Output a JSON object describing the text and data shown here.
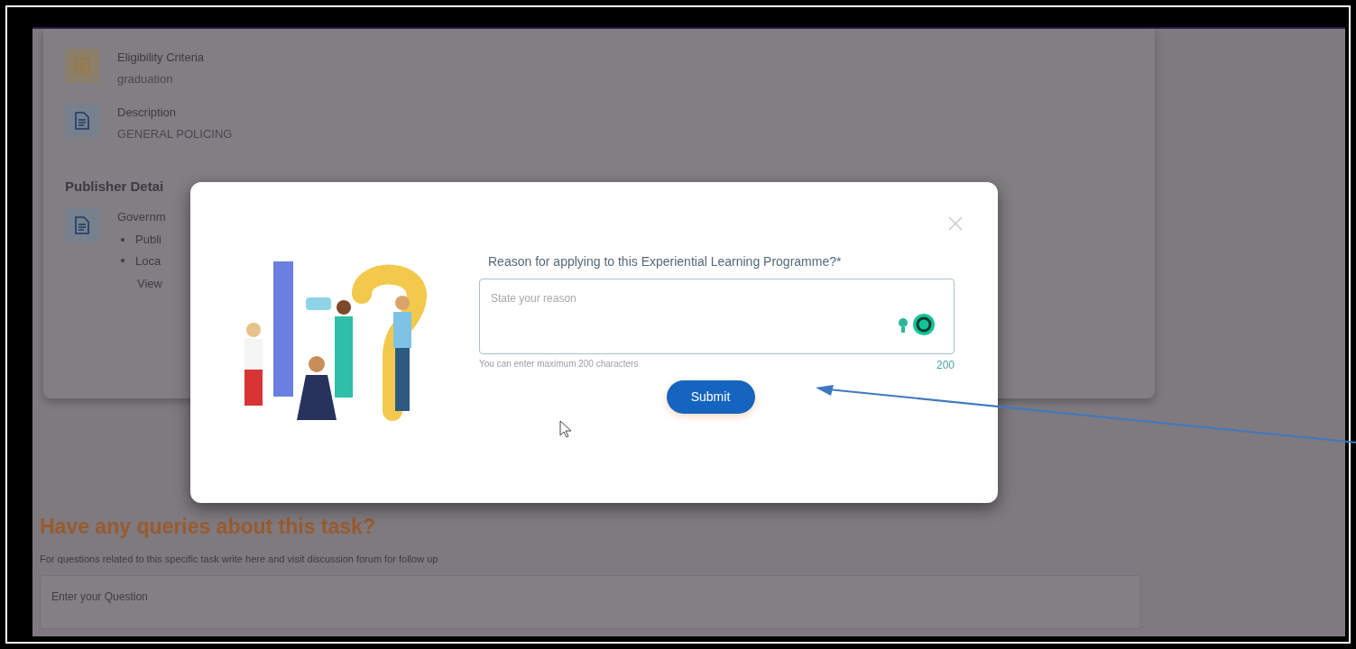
{
  "details": [
    {
      "kind": "grid",
      "label": "Eligibility Criteria",
      "value": "graduation"
    },
    {
      "kind": "document",
      "label": "Description",
      "value": "GENERAL POLICING"
    }
  ],
  "publisher": {
    "heading": "Publisher Detai",
    "label": "Governm",
    "bullets": [
      "Publi",
      "Loca"
    ],
    "link": "View"
  },
  "queries": {
    "heading": "Have any queries about this task?",
    "subtext": "For questions related to this specific task write here and visit discussion forum for follow up",
    "placeholder": "Enter your Question"
  },
  "modal": {
    "label": "Reason for applying to this Experiential Learning Programme?*",
    "placeholder": "State your reason",
    "hint": "You can enter maximum 200 characters",
    "counter": "200",
    "button": "Submit"
  }
}
